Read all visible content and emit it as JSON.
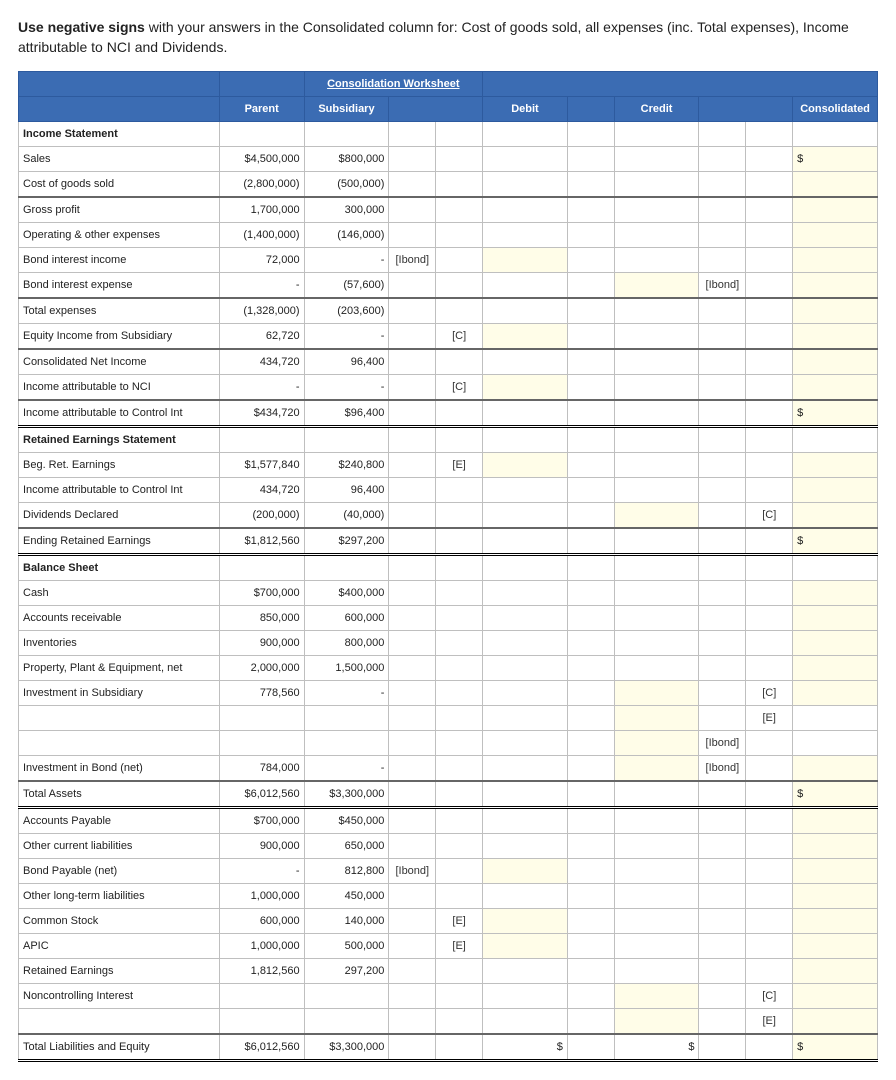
{
  "instruction_prefix": "Use negative signs",
  "instruction_rest": " with your answers in the Consolidated column for: Cost of goods sold, all expenses (inc. Total expenses), Income attributable to NCI and Dividends.",
  "header": {
    "title": "Consolidation Worksheet",
    "parent": "Parent",
    "subsidiary": "Subsidiary",
    "debit": "Debit",
    "credit": "Credit",
    "consolidated": "Consolidated"
  },
  "sections": {
    "income": "Income Statement",
    "retained": "Retained Earnings Statement",
    "balance": "Balance Sheet"
  },
  "rows": {
    "sales": {
      "l": "Sales",
      "p": "$4,500,000",
      "s": "$800,000",
      "cons": "$"
    },
    "cogs": {
      "l": "Cost of goods sold",
      "p": "(2,800,000)",
      "s": "(500,000)"
    },
    "gp": {
      "l": "Gross profit",
      "p": "1,700,000",
      "s": "300,000"
    },
    "opex": {
      "l": "Operating & other expenses",
      "p": "(1,400,000)",
      "s": "(146,000)"
    },
    "bii": {
      "l": "Bond interest income",
      "p": "72,000",
      "s": "-",
      "dref": "[Ibond]"
    },
    "bie": {
      "l": "Bond interest expense",
      "p": "-",
      "s": "(57,600)",
      "cref2": "[Ibond]"
    },
    "totexp": {
      "l": "Total expenses",
      "p": "(1,328,000)",
      "s": "(203,600)"
    },
    "eqinc": {
      "l": "Equity Income from Subsidiary",
      "p": "62,720",
      "s": "-",
      "dref2": "[C]"
    },
    "cni": {
      "l": "Consolidated Net Income",
      "p": "434,720",
      "s": "96,400"
    },
    "nci": {
      "l": "Income attributable to NCI",
      "p": "-",
      "s": "-",
      "dref2": "[C]"
    },
    "ctrl": {
      "l": "Income attributable to Control Int",
      "p": "$434,720",
      "s": "$96,400",
      "cons": "$"
    },
    "bre": {
      "l": "Beg. Ret. Earnings",
      "p": "$1,577,840",
      "s": "$240,800",
      "dref2": "[E]"
    },
    "ctrl2": {
      "l": "Income attributable to Control Int",
      "p": "434,720",
      "s": "96,400"
    },
    "div": {
      "l": "Dividends Declared",
      "p": "(200,000)",
      "s": "(40,000)",
      "cref3": "[C]"
    },
    "ere": {
      "l": "Ending Retained Earnings",
      "p": "$1,812,560",
      "s": "$297,200",
      "cons": "$"
    },
    "cash": {
      "l": "Cash",
      "p": "$700,000",
      "s": "$400,000"
    },
    "ar": {
      "l": "Accounts receivable",
      "p": "850,000",
      "s": "600,000"
    },
    "inv": {
      "l": "Inventories",
      "p": "900,000",
      "s": "800,000"
    },
    "ppe": {
      "l": "Property, Plant & Equipment, net",
      "p": "2,000,000",
      "s": "1,500,000"
    },
    "invs": {
      "l": "Investment in Subsidiary",
      "p": "778,560",
      "s": "-",
      "cref3": "[C]"
    },
    "blank1": {
      "cref3": "[E]"
    },
    "blank2": {
      "cref2": "[Ibond]"
    },
    "invb": {
      "l": "Investment in Bond (net)",
      "p": "784,000",
      "s": "-",
      "cref2": "[Ibond]"
    },
    "ta": {
      "l": "Total Assets",
      "p": "$6,012,560",
      "s": "$3,300,000",
      "cons": "$"
    },
    "ap": {
      "l": "Accounts Payable",
      "p": "$700,000",
      "s": "$450,000"
    },
    "ocl": {
      "l": "Other current liabilities",
      "p": "900,000",
      "s": "650,000"
    },
    "bp": {
      "l": "Bond Payable (net)",
      "p": "-",
      "s": "812,800",
      "dref": "[Ibond]"
    },
    "oll": {
      "l": "Other long-term liabilities",
      "p": "1,000,000",
      "s": "450,000"
    },
    "cs": {
      "l": "Common Stock",
      "p": "600,000",
      "s": "140,000",
      "dref2": "[E]"
    },
    "apic": {
      "l": "APIC",
      "p": "1,000,000",
      "s": "500,000",
      "dref2": "[E]"
    },
    "re": {
      "l": "Retained Earnings",
      "p": "1,812,560",
      "s": "297,200"
    },
    "ncib": {
      "l": "Noncontrolling Interest",
      "cref3": "[C]"
    },
    "blank3": {
      "cref3": "[E]"
    },
    "tle": {
      "l": "Total Liabilities and Equity",
      "p": "$6,012,560",
      "s": "$3,300,000",
      "d": "$",
      "c": "$",
      "cons": "$"
    }
  }
}
